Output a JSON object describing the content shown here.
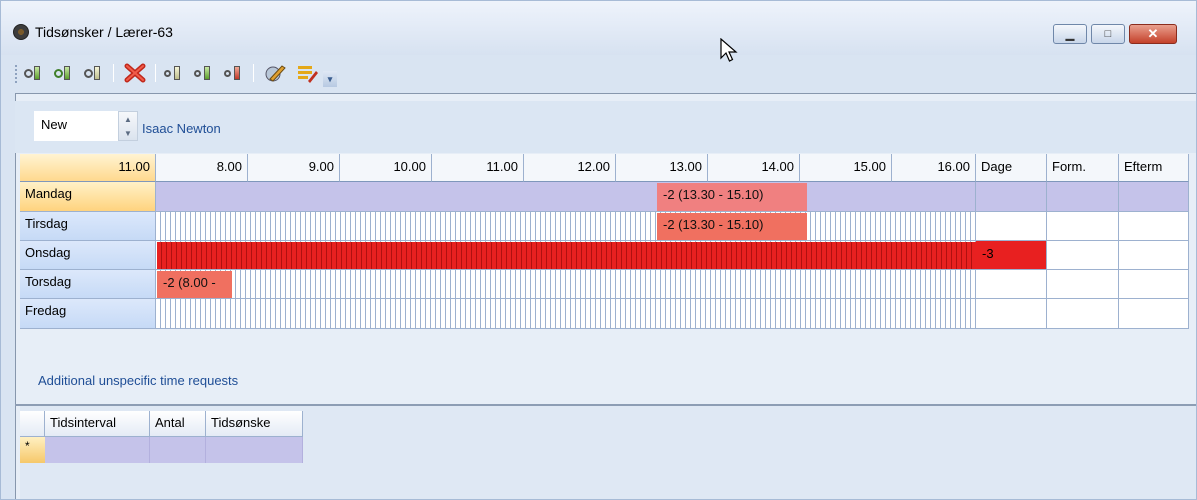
{
  "window": {
    "title": "Tidsønsker / Lærer-63",
    "controls": {
      "minimize": "▁",
      "maximize": "□",
      "close": "✕"
    }
  },
  "toolbar": {
    "buttons": [
      {
        "name": "connect-green-icon"
      },
      {
        "name": "connect-green-2-icon"
      },
      {
        "name": "connect-plain-icon"
      },
      {
        "name": "delete-x-icon"
      },
      {
        "name": "plug-plain-icon"
      },
      {
        "name": "plug-green-icon"
      },
      {
        "name": "plug-red-icon"
      },
      {
        "name": "edit-pencil-icon"
      },
      {
        "name": "highlight-icon"
      },
      {
        "name": "overflow-chevron-icon"
      }
    ]
  },
  "header": {
    "new_value": "New",
    "teacher_name": "Isaac Newton"
  },
  "grid": {
    "corner_label": "11.00",
    "hour_labels": [
      "8.00",
      "9.00",
      "10.00",
      "11.00",
      "12.00",
      "13.00",
      "14.00",
      "15.00",
      "16.00"
    ],
    "extra_columns": [
      "Dage",
      "Form.",
      "Efterm"
    ],
    "days": [
      "Mandag",
      "Tirsdag",
      "Onsdag",
      "Torsdag",
      "Fredag"
    ],
    "blocks": {
      "mandag": "-2 (13.30 - 15.10)",
      "tirsdag": "-2 (13.30 - 15.10)",
      "onsdag_dage": "-3",
      "torsdag": "-2 (8.00 -"
    },
    "colors": {
      "selected_row": "#c5c3ea",
      "soft_block": "#f08080",
      "hard_block": "#e82020"
    }
  },
  "requests": {
    "label": "Additional unspecific time requests",
    "columns": [
      "Tidsinterval",
      "Antal",
      "Tidsønske"
    ],
    "new_row_marker": "*"
  }
}
